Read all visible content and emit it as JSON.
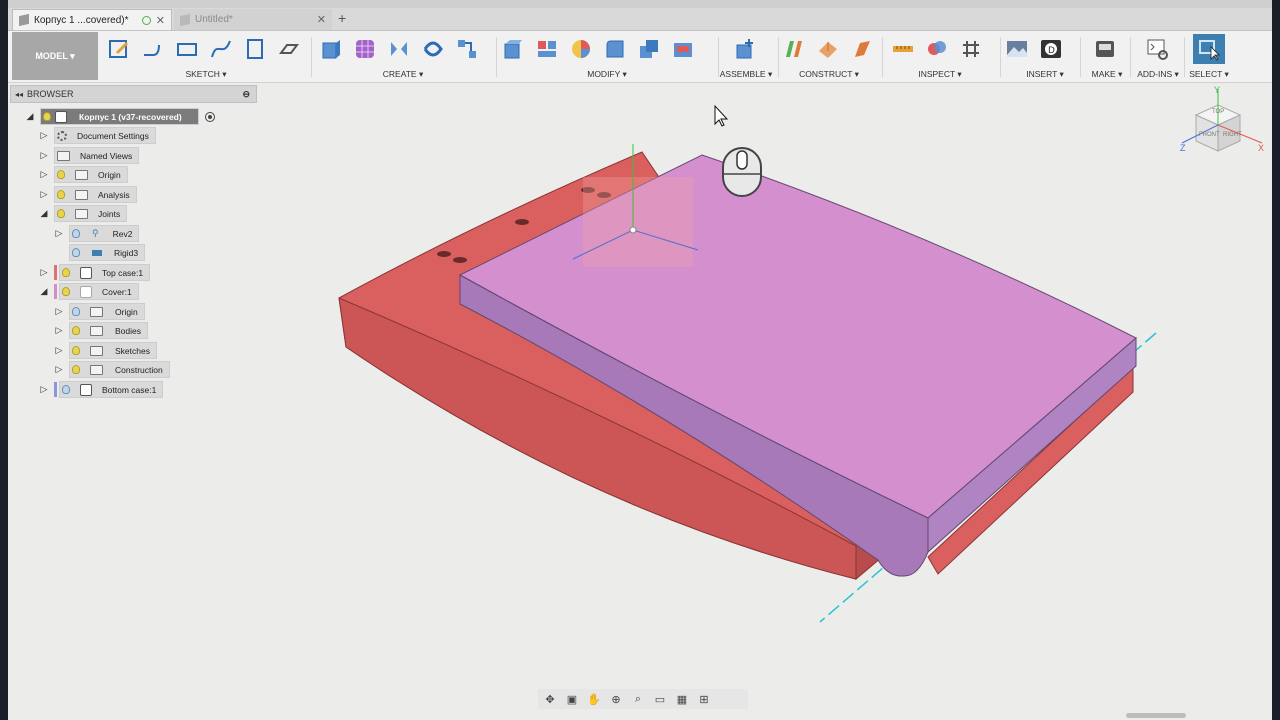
{
  "tabs": [
    {
      "label": "Корпус 1 ...covered)*",
      "active": true
    },
    {
      "label": "Untitled*",
      "active": false
    }
  ],
  "toolbar": {
    "mode": "MODEL ▾",
    "groups": [
      {
        "label": "SKETCH ▾"
      },
      {
        "label": "CREATE ▾"
      },
      {
        "label": "MODIFY ▾"
      },
      {
        "label": "ASSEMBLE ▾"
      },
      {
        "label": "CONSTRUCT ▾"
      },
      {
        "label": "INSPECT ▾"
      },
      {
        "label": "INSERT ▾"
      },
      {
        "label": "MAKE ▾"
      },
      {
        "label": "ADD-INS ▾"
      },
      {
        "label": "SELECT ▾"
      }
    ]
  },
  "browser": {
    "title": "BROWSER",
    "root": "Корпус 1 (v37-recovered)",
    "items": [
      {
        "label": "Document Settings"
      },
      {
        "label": "Named Views"
      },
      {
        "label": "Origin"
      },
      {
        "label": "Analysis"
      },
      {
        "label": "Joints"
      },
      {
        "label": "Rev2"
      },
      {
        "label": "Rigid3"
      },
      {
        "label": "Top case:1"
      },
      {
        "label": "Cover:1"
      },
      {
        "label": "Origin"
      },
      {
        "label": "Bodies"
      },
      {
        "label": "Sketches"
      },
      {
        "label": "Construction"
      },
      {
        "label": "Bottom case:1"
      }
    ]
  },
  "viewcube": {
    "front": "FRONT",
    "right": "RIGHT",
    "top": "TOP",
    "x": "X",
    "y": "Y",
    "z": "Z"
  },
  "colors": {
    "top_case": "#e07171",
    "cover": "#d38dcc",
    "bottom_case": "#8b95e6",
    "accent": "#3d7fb0"
  }
}
